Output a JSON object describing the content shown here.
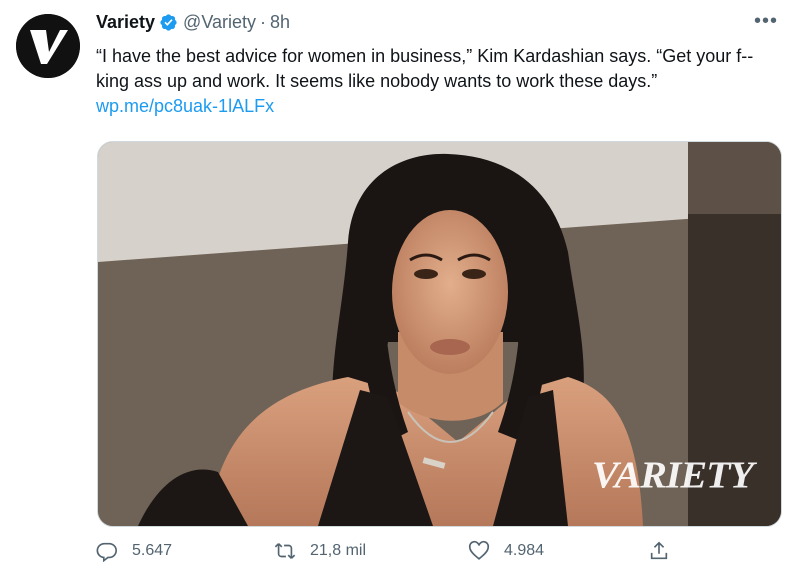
{
  "tweet": {
    "author_name": "Variety",
    "handle": "@Variety",
    "separator": "·",
    "time": "8h",
    "more_label": "•••",
    "text": "“I have the best advice for women in business,” Kim Kardashian says. “Get your f--king ass up and work. It seems like nobody wants to work these days.” ",
    "link": "wp.me/pc8uak-1lALFx"
  },
  "media": {
    "watermark": "VARIETY",
    "alt": "Kim Kardashian portrait"
  },
  "actions": {
    "replies": "5.647",
    "retweets": "21,8 mil",
    "likes": "4.984"
  },
  "colors": {
    "accent": "#1d9bf0",
    "verified": "#1d9bf0",
    "secondary_text": "#536471"
  },
  "icons": [
    "variety-logo-icon",
    "verified-badge-icon",
    "more-icon",
    "reply-icon",
    "retweet-icon",
    "like-icon",
    "share-icon"
  ]
}
